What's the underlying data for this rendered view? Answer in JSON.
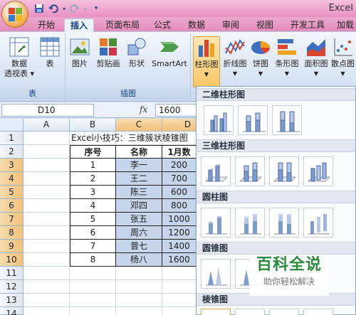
{
  "title_bar": {
    "app_title": "Excel"
  },
  "tabs": [
    {
      "label": "开始"
    },
    {
      "label": "插入"
    },
    {
      "label": "页面布局"
    },
    {
      "label": "公式"
    },
    {
      "label": "数据"
    },
    {
      "label": "审阅"
    },
    {
      "label": "视图"
    },
    {
      "label": "开发工具"
    },
    {
      "label": "加载"
    }
  ],
  "ribbon": {
    "groups": {
      "tables": {
        "label": "表",
        "buttons": [
          {
            "label": "数据\n透视表 ▾"
          },
          {
            "label": "表"
          }
        ]
      },
      "illustrations": {
        "label": "插图",
        "buttons": [
          {
            "label": "图片"
          },
          {
            "label": "剪贴画"
          },
          {
            "label": "形状"
          },
          {
            "label": "SmartArt"
          }
        ]
      },
      "charts": {
        "buttons": [
          {
            "label": "柱形图"
          },
          {
            "label": "折线图"
          },
          {
            "label": "饼图"
          },
          {
            "label": "条形图"
          },
          {
            "label": "面积图"
          },
          {
            "label": "散点图"
          }
        ]
      }
    }
  },
  "formula_bar": {
    "name_box": "D10",
    "fx_label": "fx",
    "formula": "1600"
  },
  "sheet": {
    "columns": [
      "A",
      "B",
      "C",
      "D"
    ],
    "rows": [
      "1",
      "2",
      "3",
      "4",
      "5",
      "6",
      "7",
      "8",
      "9",
      "10",
      "11",
      "12",
      "13",
      "14"
    ],
    "title_cell": "Excel小技巧：三维簇状棱锥图",
    "headers": [
      "序号",
      "名称",
      "1月数"
    ],
    "data": [
      [
        "1",
        "李一",
        "200"
      ],
      [
        "2",
        "王二",
        "700"
      ],
      [
        "3",
        "陈三",
        "600"
      ],
      [
        "4",
        "邓四",
        "800"
      ],
      [
        "5",
        "张五",
        "1000"
      ],
      [
        "6",
        "周六",
        "1200"
      ],
      [
        "7",
        "曾七",
        "1400"
      ],
      [
        "8",
        "杨八",
        "1600"
      ]
    ]
  },
  "gallery": {
    "sections": [
      {
        "title": "二维柱形图"
      },
      {
        "title": "三维柱形图"
      },
      {
        "title": "圆柱图"
      },
      {
        "title": "圆锥图"
      },
      {
        "title": "棱锥图"
      }
    ]
  },
  "watermark": {
    "main": "百科全说",
    "sub": "助你轻松解决"
  }
}
